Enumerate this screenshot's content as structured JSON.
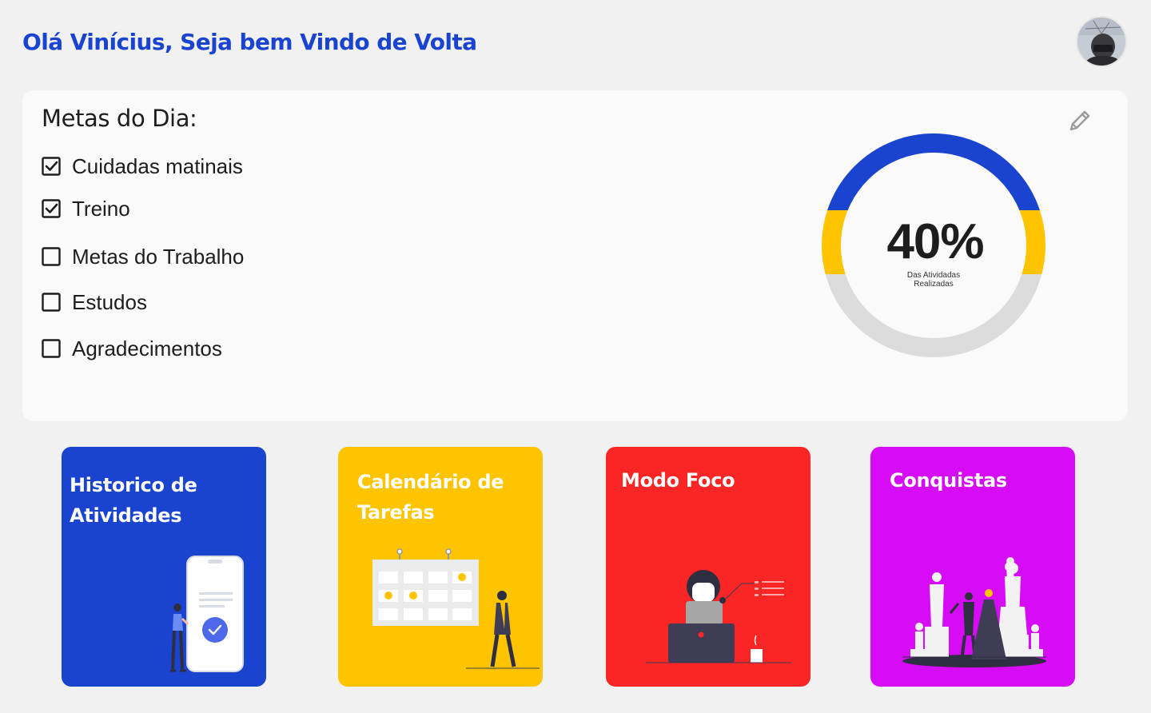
{
  "header": {
    "greeting": "Olá Vinícius, Seja bem Vindo de Volta"
  },
  "goals": {
    "title": "Metas do Dia:",
    "items": [
      {
        "label": "Cuidadas matinais",
        "checked": true
      },
      {
        "label": "Treino",
        "checked": true
      },
      {
        "label": "Metas do Trabalho",
        "checked": false
      },
      {
        "label": "Estudos",
        "checked": false
      },
      {
        "label": "Agradecimentos",
        "checked": false
      }
    ]
  },
  "progress": {
    "value": "40%",
    "caption_line1": "Das Atividadas",
    "caption_line2": "Realizadas"
  },
  "cards": [
    {
      "title_line1": "Historico de",
      "title_line2": "Atividades"
    },
    {
      "title_line1": "Calendário de",
      "title_line2": "Tarefas"
    },
    {
      "title_line1": "Modo Foco",
      "title_line2": ""
    },
    {
      "title_line1": "Conquistas",
      "title_line2": ""
    }
  ],
  "colors": {
    "brand_blue": "#1a44cf",
    "yellow": "#ffc400",
    "red": "#fa2525",
    "purple": "#d50cf5",
    "gray_track": "#dcdcdc"
  },
  "icons": {
    "edit": "pencil-icon",
    "checked": "checkbox-checked-icon",
    "unchecked": "checkbox-unchecked-icon"
  }
}
